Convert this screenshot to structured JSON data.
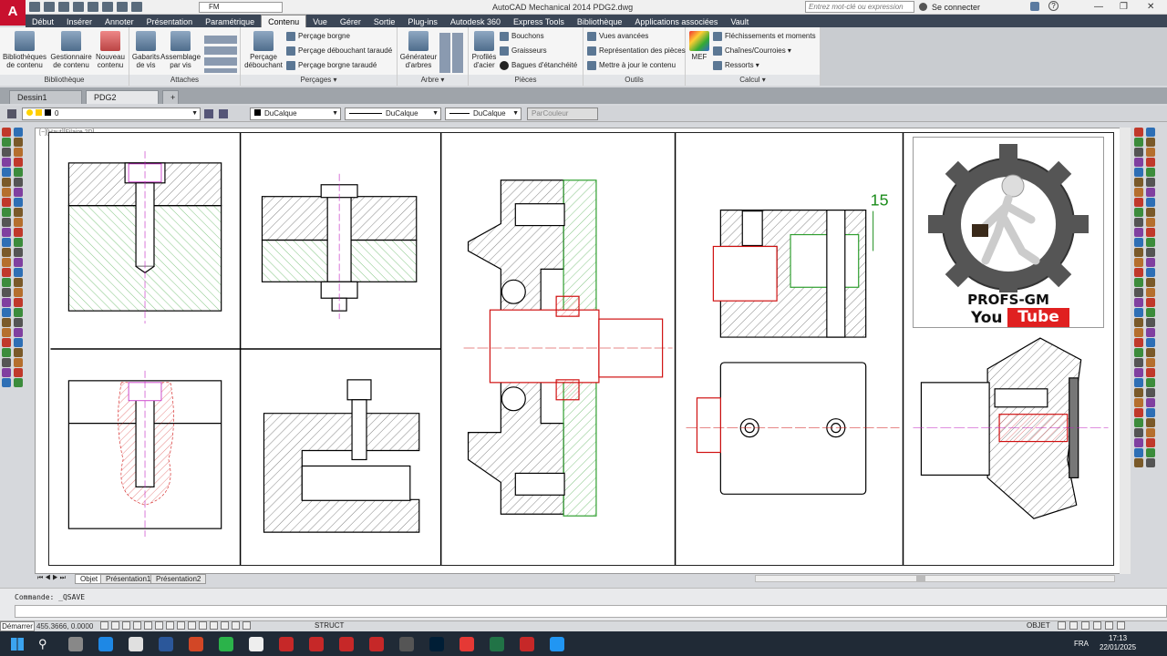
{
  "app": {
    "logo": "A",
    "title": "AutoCAD Mechanical 2014    PDG2.dwg",
    "workspace": "FM"
  },
  "search": {
    "placeholder": "Entrez mot-clé ou expression"
  },
  "account": {
    "signin": "Se connecter"
  },
  "ribbon_tabs": [
    "Début",
    "Insérer",
    "Annoter",
    "Présentation",
    "Paramétrique",
    "Contenu",
    "Vue",
    "Gérer",
    "Sortie",
    "Plug-ins",
    "Autodesk 360",
    "Express Tools",
    "Bibliothèque",
    "Applications associées",
    "Vault"
  ],
  "active_tab": "Contenu",
  "ribbon": {
    "bibliotheque": {
      "title": "Bibliothèque",
      "buttons": [
        "Bibliothèques de contenu",
        "Gestionnaire de contenu",
        "Nouveau contenu"
      ]
    },
    "attaches": {
      "title": "Attaches",
      "buttons": [
        "Gabarits de vis",
        "Assemblage par vis"
      ]
    },
    "percages": {
      "title": "Perçages",
      "big": "Perçage débouchant",
      "items": [
        "Perçage borgne",
        "Perçage débouchant taraudé",
        "Perçage borgne taraudé"
      ]
    },
    "arbre": {
      "title": "Arbre",
      "big": "Générateur d'arbres"
    },
    "pieces": {
      "title": "Pièces",
      "big": "Profilés d'acier",
      "items": [
        "Bouchons",
        "Graisseurs",
        "Bagues d'étanchéité"
      ]
    },
    "outils": {
      "title": "Outils",
      "items": [
        "Vues avancées",
        "Représentation des pièces",
        "Mettre à jour le contenu"
      ]
    },
    "calcul": {
      "title": "Calcul",
      "big": "MEF",
      "items": [
        "Fléchissements et moments",
        "Chaînes/Courroies",
        "Ressorts"
      ]
    }
  },
  "doc_tabs": [
    "Dessin1",
    "PDG2"
  ],
  "active_doc": "PDG2",
  "layer": {
    "current": "0",
    "color": "DuCalque",
    "linetype": "DuCalque",
    "lineweight": "DuCalque",
    "plotstyle": "ParCouleur"
  },
  "viewport_label": "[−][Haut][Filaire 2D]",
  "dimension_text": "15",
  "logo": {
    "line1": "PROFS-GM",
    "you": "You",
    "tube": "Tube"
  },
  "layout_tabs": [
    "Objet",
    "Présentation1",
    "Présentation2"
  ],
  "command": {
    "history": "Commande:  _QSAVE",
    "input": ""
  },
  "status": {
    "start": "Démarrer",
    "coords": "455.3666, 0.0000",
    "struct": "STRUCT",
    "objet": "OBJET"
  },
  "tray": {
    "lang": "FRA",
    "time": "17:13",
    "date": "22/01/2025"
  },
  "colors": {
    "accent": "#c8102e",
    "ribbon_bg": "#f5f5f5",
    "tab_bar": "#3b4656",
    "taskbar": "#202a36",
    "hatch_green": "#2e9e2e",
    "part_red": "#d01010"
  }
}
